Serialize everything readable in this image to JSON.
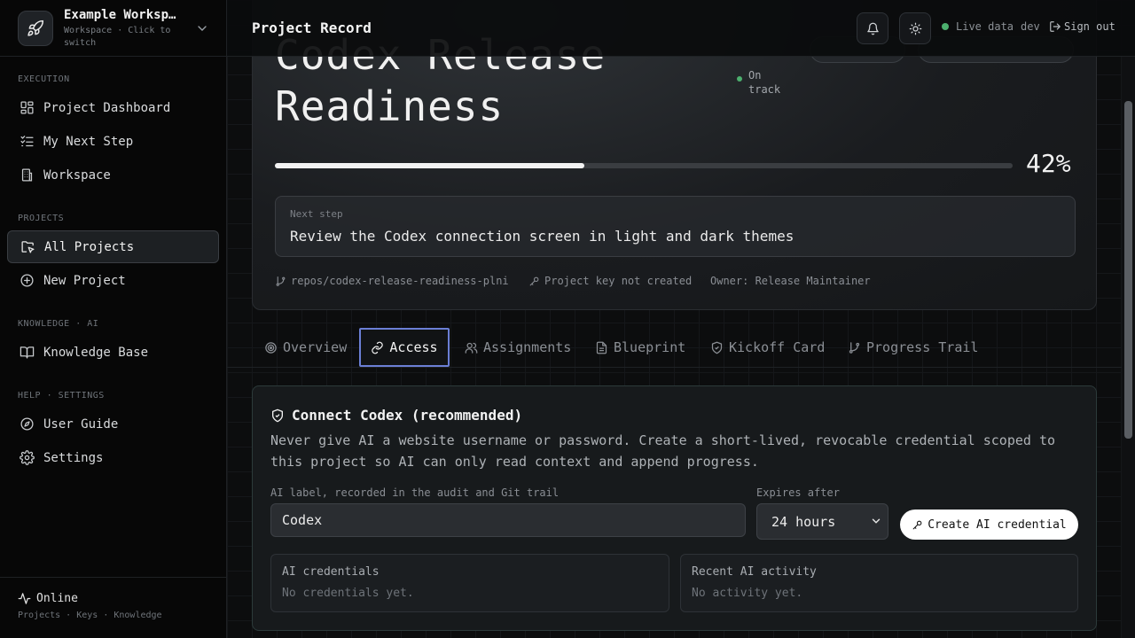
{
  "workspace": {
    "name": "Example Worksp…",
    "subtitle": "Workspace · Click to switch"
  },
  "sidebar": {
    "sections": [
      {
        "label": "EXECUTION"
      },
      {
        "label": "PROJECTS"
      },
      {
        "label": "KNOWLEDGE · AI"
      },
      {
        "label": "HELP · SETTINGS"
      }
    ],
    "items": [
      {
        "label": "Project Dashboard",
        "icon": "dashboard-icon"
      },
      {
        "label": "My Next Step",
        "icon": "checklist-icon"
      },
      {
        "label": "Workspace",
        "icon": "building-icon"
      },
      {
        "label": "All Projects",
        "icon": "folder-cursor-icon",
        "active": true
      },
      {
        "label": "New Project",
        "icon": "plus-circle-icon"
      },
      {
        "label": "Knowledge Base",
        "icon": "book-icon"
      },
      {
        "label": "User Guide",
        "icon": "compass-icon"
      },
      {
        "label": "Settings",
        "icon": "gear-icon"
      }
    ],
    "footer": {
      "status": "Online",
      "sub": "Projects · Keys · Knowledge"
    }
  },
  "topbar": {
    "title": "Project Record",
    "live": "Live data",
    "env": "dev",
    "signout": "Sign out"
  },
  "project": {
    "title": "Codex Release Readiness",
    "status": "On track",
    "progress_pct": 42,
    "progress_label": "42%",
    "next_step_label": "Next step",
    "next_step": "Review the Codex connection screen in light and dark themes",
    "repo": "repos/codex-release-readiness-plni",
    "key": "Project key not created",
    "owner": "Owner: Release Maintainer"
  },
  "tabs": [
    {
      "label": "Overview",
      "icon": "target-icon"
    },
    {
      "label": "Access",
      "icon": "link-icon",
      "active": true
    },
    {
      "label": "Assignments",
      "icon": "users-icon"
    },
    {
      "label": "Blueprint",
      "icon": "document-icon"
    },
    {
      "label": "Kickoff Card",
      "icon": "shield-icon"
    },
    {
      "label": "Progress Trail",
      "icon": "branch-icon"
    }
  ],
  "connect": {
    "title": "Connect Codex (recommended)",
    "description": "Never give AI a website username or password. Create a short-lived, revocable credential scoped to this project so AI can only read context and append progress.",
    "label_field": {
      "label": "AI label, recorded in the audit and Git trail",
      "value": "Codex"
    },
    "expires": {
      "label": "Expires after",
      "value": "24 hours"
    },
    "create_button": "Create AI credential",
    "credentials": {
      "title": "AI credentials",
      "empty": "No credentials yet."
    },
    "activity": {
      "title": "Recent AI activity",
      "empty": "No activity yet."
    }
  },
  "colors": {
    "accent": "#6b7fd6",
    "ok": "#4caf6e",
    "progress": "#f2f2f2"
  }
}
